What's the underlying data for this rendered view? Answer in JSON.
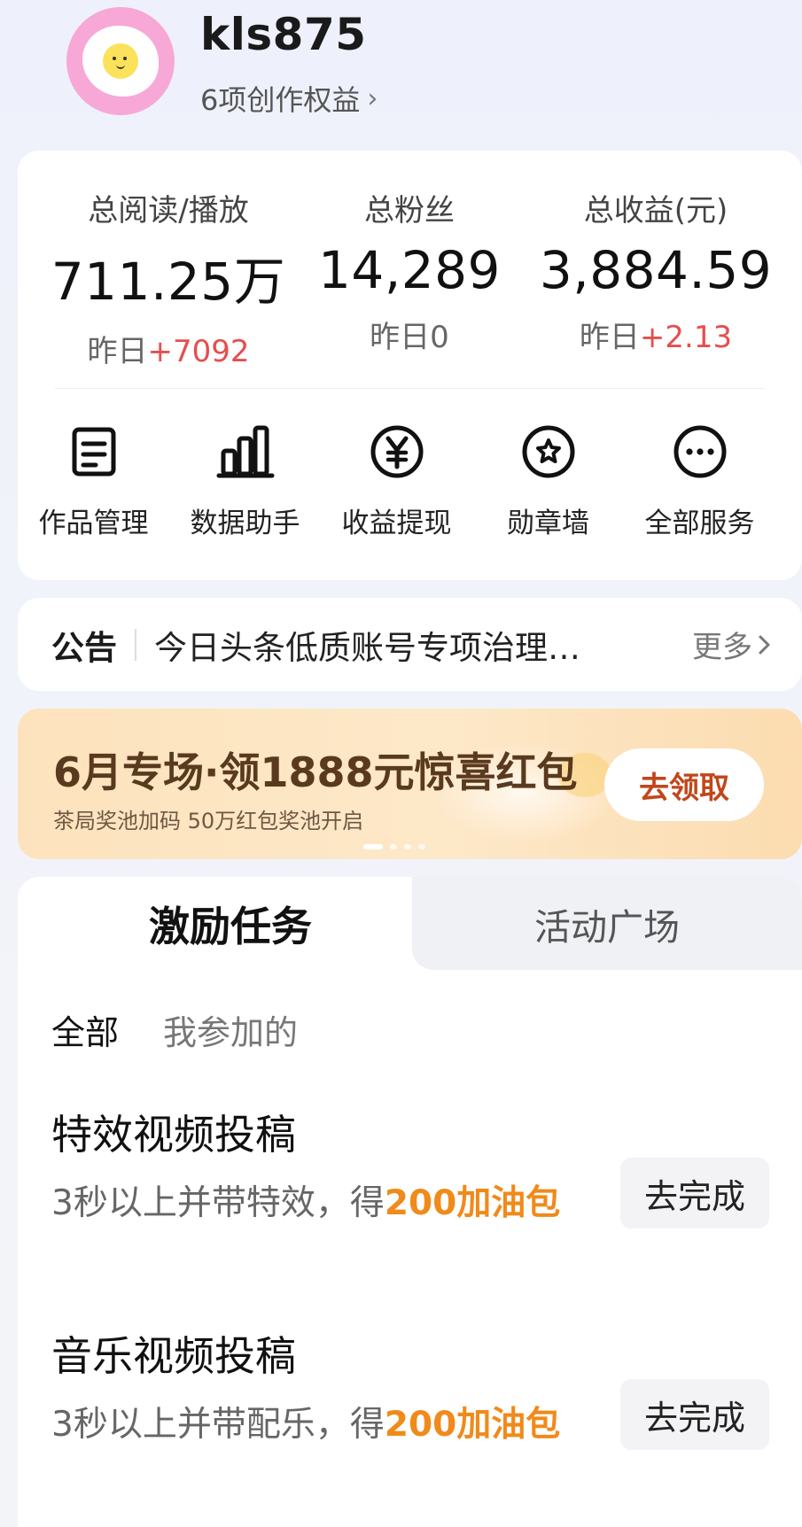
{
  "profile": {
    "username": "kls875",
    "rights_text": "6项创作权益",
    "rights_chevron": "›"
  },
  "stats": [
    {
      "label": "总阅读/播放",
      "value": "711.25万",
      "delta_prefix": "昨日",
      "delta_value": "+7092"
    },
    {
      "label": "总粉丝",
      "value": "14,289",
      "delta_prefix": "昨日",
      "delta_value": "0"
    },
    {
      "label": "总收益(元)",
      "value": "3,884.59",
      "delta_prefix": "昨日",
      "delta_value": "+2.13"
    }
  ],
  "tools": [
    {
      "label": "作品管理",
      "icon": "document-icon"
    },
    {
      "label": "数据助手",
      "icon": "bar-chart-icon"
    },
    {
      "label": "收益提现",
      "icon": "yuan-icon"
    },
    {
      "label": "勋章墙",
      "icon": "medal-icon"
    },
    {
      "label": "全部服务",
      "icon": "more-icon"
    }
  ],
  "notice": {
    "title": "公告",
    "text": "今日头条低质账号专项治理…",
    "more": "更多"
  },
  "banner": {
    "title": "6月专场·领1888元惊喜红包",
    "subtitle": "茶局奖池加码 50万红包奖池开启",
    "button": "去领取"
  },
  "tabs": {
    "active": "激励任务",
    "inactive": "活动广场"
  },
  "filters": {
    "all": "全部",
    "joined": "我参加的"
  },
  "tasks": [
    {
      "name": "特效视频投稿",
      "desc_prefix": "3秒以上并带特效，得",
      "reward": "200加油包",
      "button": "去完成"
    },
    {
      "name": "音乐视频投稿",
      "desc_prefix": "3秒以上并带配乐，得",
      "reward": "200加油包",
      "button": "去完成"
    }
  ],
  "colors": {
    "accent_red": "#e84d4d",
    "reward_orange": "#f08a1a",
    "banner_button_text": "#c0471b"
  }
}
